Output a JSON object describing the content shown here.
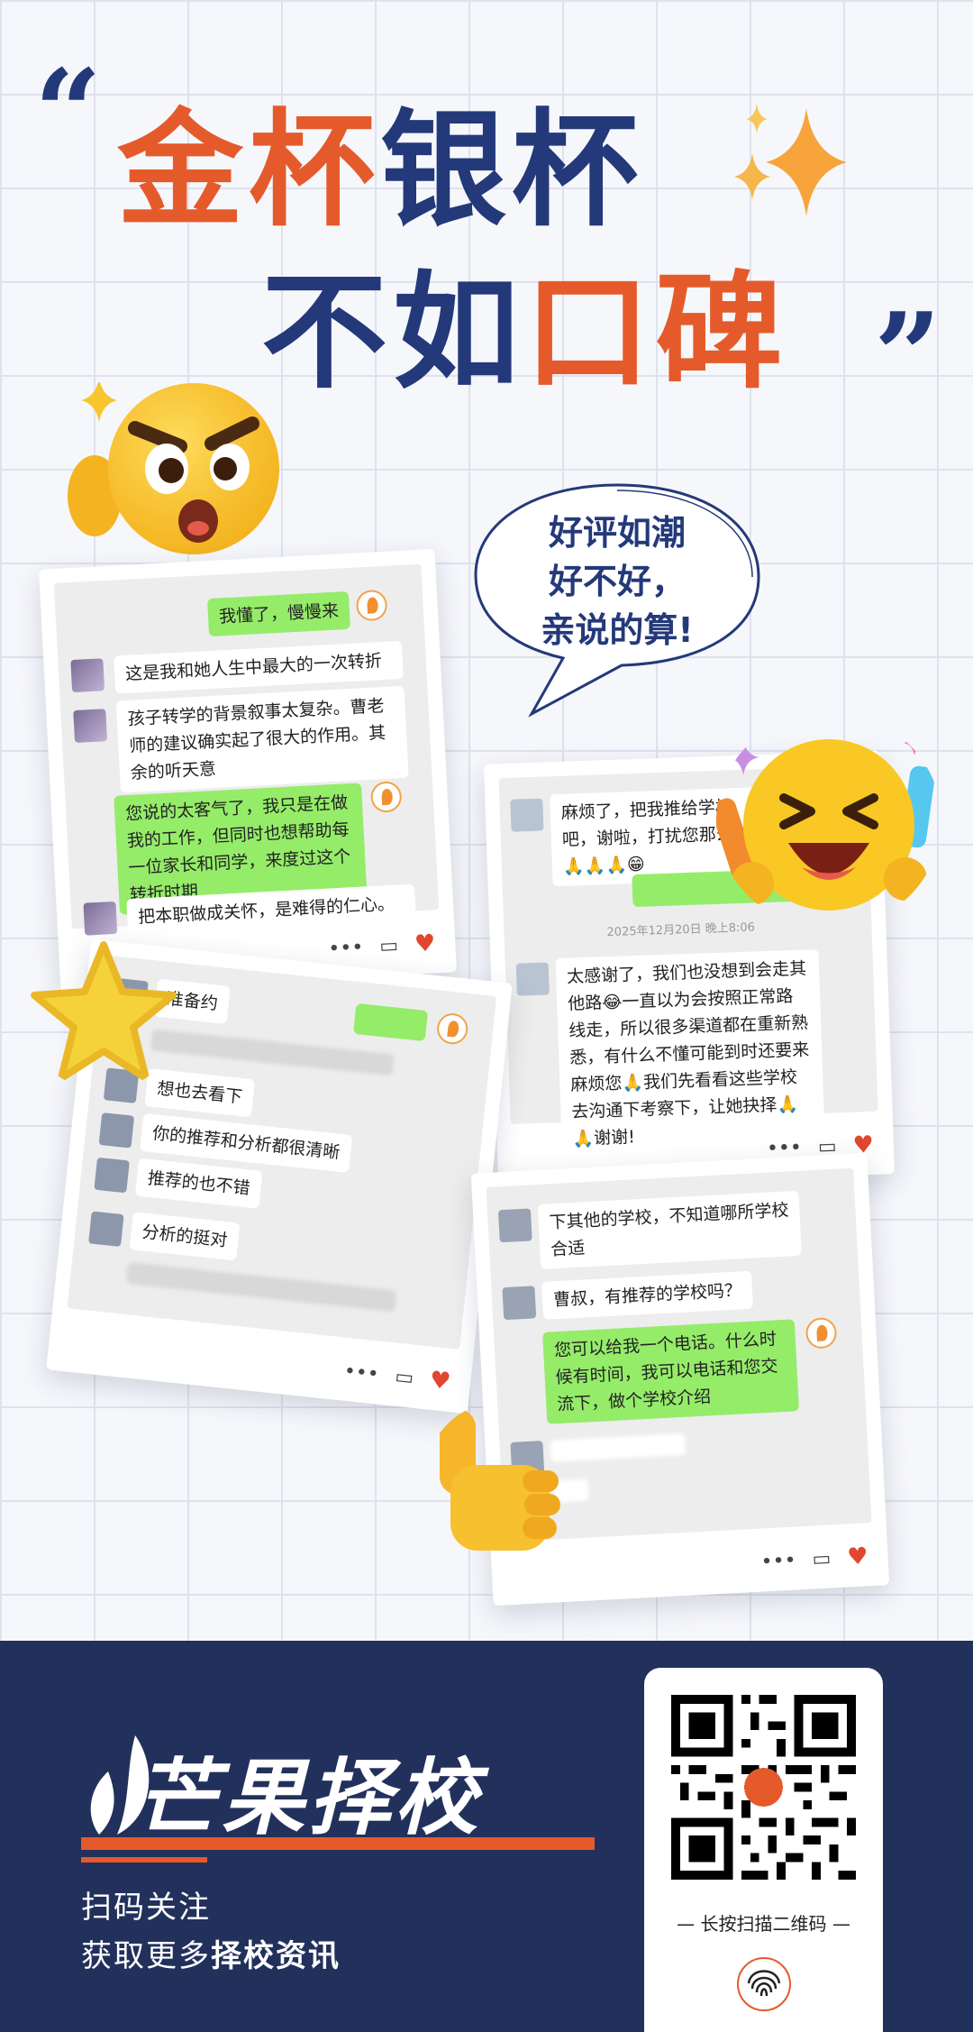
{
  "hero": {
    "quote_open": "“",
    "quote_close": "”",
    "line1_a": "金杯",
    "line1_b": "银杯",
    "line2_a": "不如",
    "line2_b": "口碑"
  },
  "bubble": {
    "line1": "好评如潮",
    "line2": "好不好，",
    "line3": "亲说的算!"
  },
  "card1": {
    "m1": "我懂了，慢慢来",
    "m2": "这是我和她人生中最大的一次转折",
    "m3": "孩子转学的背景叙事太复杂。曹老师的建议确实起了很大的作用。其余的听天意",
    "m4": "您说的太客气了，我只是在做我的工作，但同时也想帮助每一位家长和同学，来度过这个转折时期",
    "m5": "把本职做成关怀，是难得的仁心。"
  },
  "card2": {
    "m1": "麻烦了，把我推给学校吧，谢啦，打扰您那么久🙏🙏🙏😁",
    "time": "2025年12月20日 晚上8:06",
    "m2": "太感谢了，我们也没想到会走其他路😂一直以为会按照正常路线走，所以很多渠道都在重新熟悉，有什么不懂可能到时还要来麻烦您🙏我们先看看这些学校去沟通下考察下，让她抉择🙏🙏谢谢!"
  },
  "card3": {
    "m1": "准备约",
    "m2": "想也去看下",
    "m3": "你的推荐和分析都很清晰",
    "m4": "推荐的也不错",
    "m5": "分析的挺对"
  },
  "card4": {
    "m1": "下其他的学校，不知道哪所学校合适",
    "m2": "曹叔，有推荐的学校吗？",
    "m3": "您可以给我一个电话。什么时候有时间，我可以电话和您交流下，做个学校介绍"
  },
  "footer": {
    "brand": "芒果择校",
    "scan_line1": "扫码关注",
    "scan_line2_a": "获取更多",
    "scan_line2_b": "择校资讯",
    "qr_caption": "— 长按扫描二维码 —"
  },
  "colors": {
    "orange": "#e55a2b",
    "navy": "#24397a",
    "footer_bg": "#22305c",
    "chat_green": "#95ec69"
  }
}
